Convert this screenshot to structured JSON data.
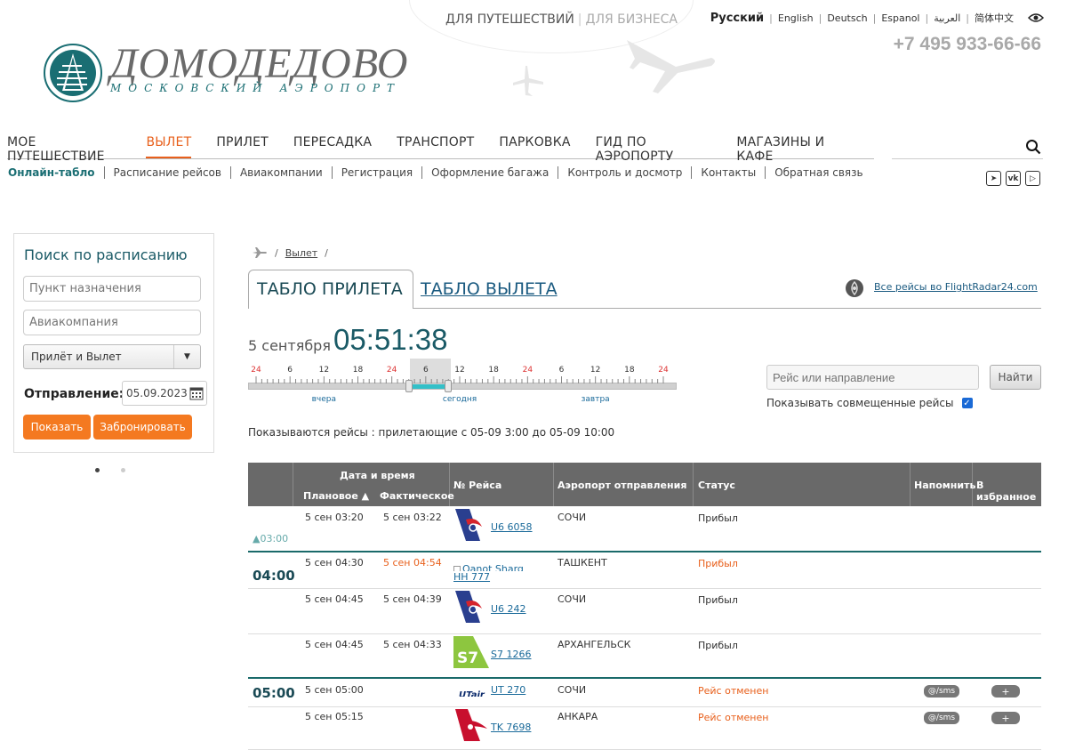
{
  "header": {
    "audience": {
      "travel": "ДЛЯ ПУТЕШЕСТВИЙ",
      "business": "ДЛЯ БИЗНЕСА"
    },
    "languages": [
      "Русский",
      "English",
      "Deutsch",
      "Espanol",
      "العربية",
      "简体中文"
    ],
    "active_language": "Русский",
    "phone": "+7 495 933-66-66",
    "logo": {
      "name": "ДОМОДЕДОВО",
      "subtitle": "МОСКОВСКИЙ АЭРОПОРТ"
    }
  },
  "mainnav": [
    {
      "label": "МОЕ ПУТЕШЕСТВИЕ",
      "active": false
    },
    {
      "label": "ВЫЛЕТ",
      "active": true
    },
    {
      "label": "ПРИЛЕТ",
      "active": false
    },
    {
      "label": "ПЕРЕСАДКА",
      "active": false
    },
    {
      "label": "ТРАНСПОРТ",
      "active": false
    },
    {
      "label": "ПАРКОВКА",
      "active": false
    },
    {
      "label": "ГИД ПО АЭРОПОРТУ",
      "active": false
    },
    {
      "label": "МАГАЗИНЫ И КАФЕ",
      "active": false
    }
  ],
  "subnav": [
    {
      "label": "Онлайн-табло",
      "active": true
    },
    {
      "label": "Расписание рейсов",
      "active": false
    },
    {
      "label": "Авиакомпании",
      "active": false
    },
    {
      "label": "Регистрация",
      "active": false
    },
    {
      "label": "Оформление багажа",
      "active": false
    },
    {
      "label": "Контроль и досмотр",
      "active": false
    },
    {
      "label": "Контакты",
      "active": false
    },
    {
      "label": "Обратная связь",
      "active": false
    }
  ],
  "search_panel": {
    "title": "Поиск по расписанию",
    "destination_placeholder": "Пункт назначения",
    "airline_placeholder": "Авиакомпания",
    "mode_value": "Прилёт и Вылет",
    "departure_label": "Отправление:",
    "date_value": "05.09.2023",
    "show_button": "Показать",
    "book_button": "Забронировать"
  },
  "breadcrumb": {
    "current": "Вылет"
  },
  "tabs": {
    "arrivals": "ТАБЛО ПРИЛЕТА",
    "departures": "ТАБЛО ВЫЛЕТА"
  },
  "flightradar_link": "Все рейсы во FlightRadar24.com",
  "clock": {
    "date": "5 сентября",
    "time": "05:51:38"
  },
  "timeline": {
    "hours": [
      "24",
      "6",
      "12",
      "18",
      "24",
      "6",
      "12",
      "18",
      "24",
      "6",
      "12",
      "18",
      "24"
    ],
    "days": [
      "вчера",
      "сегодня",
      "завтра"
    ],
    "selection_start_hour": 3,
    "selection_end_hour": 10
  },
  "flight_search": {
    "placeholder": "Рейс или направление",
    "button": "Найти",
    "combined_label": "Показывать совмещенные рейсы",
    "combined_checked": true
  },
  "shown_text": "Показываются рейсы : прилетающие с 05-09 3:00 до 05-09 10:00",
  "table": {
    "headers": {
      "datetime": "Дата и время",
      "planned": "Плановое ▲",
      "actual": "Фактическое",
      "flight": "№ Рейса",
      "airport": "Аэропорт отправления",
      "status": "Статус",
      "remind": "Напомнить",
      "favorite": "В избранное"
    },
    "rows": [
      {
        "hour": "▲03:00",
        "hour_style": "small",
        "planned": "5 сен  03:20",
        "actual": "5 сен  03:22",
        "actual_late": false,
        "airline": "ural",
        "flight": "U6 6058",
        "airport": "СОЧИ",
        "status": "Прибыл",
        "status_alert": false,
        "remind": "",
        "fav": ""
      },
      {
        "hour": "04:00",
        "hour_style": "big",
        "planned": "5 сен  04:30",
        "actual": "5 сен  04:54",
        "actual_late": true,
        "airline": "qanot",
        "airline_alt": "Qanot Sharq",
        "flight": "HH 777",
        "airport": "ТАШКЕНТ",
        "status": "Прибыл",
        "status_alert": true,
        "remind": "",
        "fav": ""
      },
      {
        "hour": "",
        "hour_style": "",
        "planned": "5 сен  04:45",
        "actual": "5 сен  04:39",
        "actual_late": false,
        "airline": "ural",
        "flight": "U6 242",
        "airport": "СОЧИ",
        "status": "Прибыл",
        "status_alert": false,
        "remind": "",
        "fav": ""
      },
      {
        "hour": "",
        "hour_style": "",
        "planned": "5 сен  04:45",
        "actual": "5 сен  04:33",
        "actual_late": false,
        "airline": "s7",
        "flight": "S7 1266",
        "airport": "АРХАНГЕЛЬСК",
        "status": "Прибыл",
        "status_alert": false,
        "remind": "",
        "fav": ""
      },
      {
        "hour": "05:00",
        "hour_style": "big",
        "planned": "5 сен  05:00",
        "actual": "",
        "actual_late": false,
        "airline": "utair",
        "airline_text": "UTair",
        "flight": "UT 270",
        "airport": "СОЧИ",
        "status": "Рейс отменен",
        "status_alert": true,
        "remind": "@/sms",
        "fav": "+"
      },
      {
        "hour": "",
        "hour_style": "",
        "planned": "5 сен  05:15",
        "actual": "",
        "actual_late": false,
        "airline": "turkish",
        "flight": "TK 7698",
        "airport": "АНКАРА",
        "status": "Рейс отменен",
        "status_alert": true,
        "remind": "@/sms",
        "fav": "+"
      }
    ]
  },
  "colors": {
    "accent": "#e8601c",
    "brand": "#1a6e73",
    "header_bg": "#696969",
    "button": "#f47920"
  }
}
